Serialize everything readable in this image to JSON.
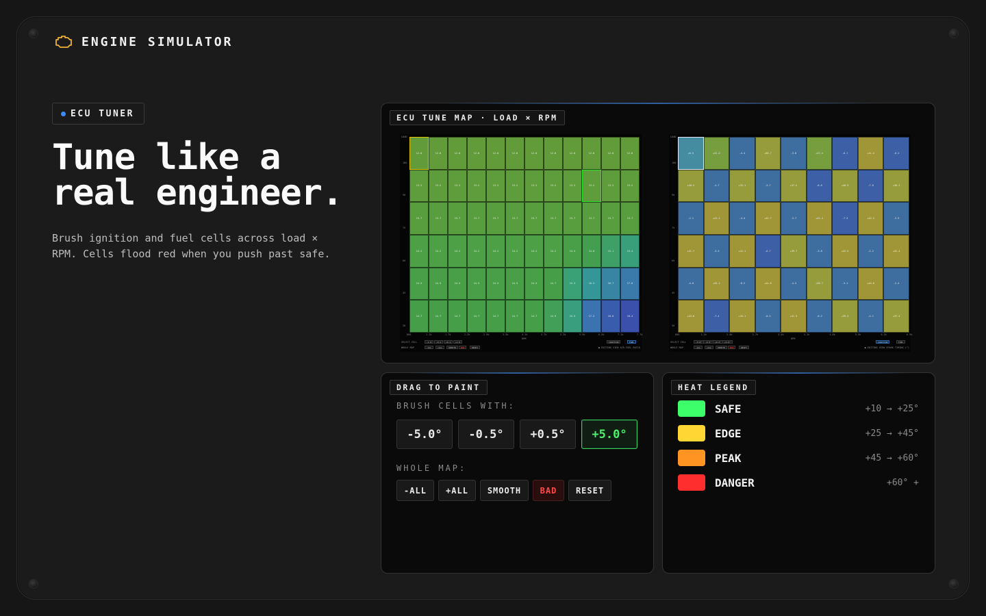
{
  "app": {
    "title": "ENGINE SIMULATOR",
    "icon": "engine-check-icon"
  },
  "hero": {
    "badge": "ECU TUNER",
    "title_line1": "Tune like a",
    "title_line2": "real engineer.",
    "subtitle": "Brush ignition and fuel cells across load × RPM. Cells flood red when you push past safe."
  },
  "map_panel": {
    "tag": "ECU TUNE MAP · LOAD × RPM",
    "fuel_map": {
      "y_labels": [
        "100",
        "90",
        "75",
        "60",
        "45",
        "30"
      ],
      "x_labels": [
        "800",
        "1.1k",
        "1.7k",
        "2.3k",
        "2.9k",
        "3.5k",
        "4.1k",
        "4.7k",
        "5.3k",
        "5.9k",
        "6.5k",
        "7.1k",
        "7.7k"
      ],
      "x_axis": "RPM",
      "rows": [
        [
          "12.8",
          "12.8",
          "12.8",
          "12.8",
          "12.8",
          "12.8",
          "12.8",
          "12.8",
          "12.8",
          "12.8",
          "12.8",
          "12.8"
        ],
        [
          "13.2",
          "13.2",
          "13.2",
          "13.2",
          "13.2",
          "13.2",
          "13.2",
          "13.2",
          "13.2",
          "13.2",
          "13.2",
          "13.2"
        ],
        [
          "13.7",
          "13.7",
          "13.7",
          "13.7",
          "13.7",
          "13.7",
          "13.7",
          "13.7",
          "13.7",
          "13.7",
          "13.7",
          "13.7"
        ],
        [
          "14.2",
          "14.2",
          "14.2",
          "14.2",
          "14.2",
          "14.2",
          "14.2",
          "14.2",
          "14.5",
          "14.8",
          "15.1",
          "15.4"
        ],
        [
          "14.5",
          "14.5",
          "14.5",
          "14.5",
          "14.5",
          "14.5",
          "14.5",
          "14.7",
          "15.3",
          "16.2",
          "16.7",
          "17.0"
        ],
        [
          "14.7",
          "14.7",
          "14.7",
          "14.7",
          "14.7",
          "14.7",
          "14.7",
          "14.9",
          "15.5",
          "17.2",
          "18.0",
          "18.4"
        ]
      ],
      "footer_row1": "SELECT CELL",
      "footer_row2": "WHOLE MAP",
      "mini_cells": [
        "-1.0",
        "-0.1",
        "+0.1",
        "+1.0"
      ],
      "mini_map": [
        "-ALL",
        "+ALL",
        "SMOOTH",
        "BAD",
        "RESET"
      ],
      "toggle": [
        "IGNITION",
        "FUEL"
      ],
      "caption": "● EDITING VIEW  AIR-FUEL RATIO"
    },
    "ignition_map": {
      "y_labels": [
        "100",
        "90",
        "75",
        "60",
        "45",
        "30"
      ],
      "x_labels": [
        "800",
        "1.2k",
        "2.0k",
        "2.7k",
        "3.4k",
        "4.1k",
        "4.8k",
        "5.5k",
        "6.2k",
        "6.9k"
      ],
      "x_axis": "RPM",
      "rows": [
        [
          "+0.5",
          "+31.2",
          "-4.4",
          "+38.7",
          "-3.8",
          "+27.4",
          "-6.7",
          "+41.2",
          "-6.2"
        ],
        [
          "+40.5",
          "-4.7",
          "+35.1",
          "-3.7",
          "+37.2",
          "-6.6",
          "+40.3",
          "-7.8",
          "+38.2"
        ],
        [
          "-2.1",
          "+41.1",
          "-4.4",
          "+42.7",
          "-3.7",
          "+41.4",
          "-7.3",
          "+42.3",
          "-3.9"
        ],
        [
          "+41.7",
          "-3.3",
          "+41.1",
          "-6.7",
          "+39.7",
          "-3.8",
          "+42.5",
          "-2.2",
          "+42.4"
        ],
        [
          "-4.0",
          "+43.1",
          "-0.2",
          "+44.8",
          "-4.5",
          "+36.7",
          "-3.1",
          "+44.6",
          "-2.4"
        ],
        [
          "+43.8",
          "-7.4",
          "+43.1",
          "-0.2",
          "+41.3",
          "-0.2",
          "+39.4",
          "-4.1",
          "+37.4"
        ]
      ],
      "footer_row1": "SELECT CELL",
      "footer_row2": "WHOLE MAP",
      "mini_cells": [
        "-5.0°",
        "-0.5°",
        "+0.5°",
        "+5.0°"
      ],
      "mini_map": [
        "-ALL",
        "+ALL",
        "SMOOTH",
        "BAD",
        "RESET"
      ],
      "toggle": [
        "IGNITION",
        "FUEL"
      ],
      "caption": "● EDITING VIEW  SPARK TIMING (°)"
    }
  },
  "paint_panel": {
    "tag": "DRAG TO PAINT",
    "brush_label": "BRUSH CELLS WITH:",
    "brush_buttons": [
      "-5.0°",
      "-0.5°",
      "+0.5°",
      "+5.0°"
    ],
    "active_brush": "+5.0°",
    "whole_label": "WHOLE MAP:",
    "whole_buttons": [
      "-ALL",
      "+ALL",
      "SMOOTH",
      "BAD",
      "RESET"
    ]
  },
  "legend_panel": {
    "tag": "HEAT LEGEND",
    "items": [
      {
        "name": "SAFE",
        "range": "+10 → +25°",
        "color": "#3dff6a"
      },
      {
        "name": "EDGE",
        "range": "+25 → +45°",
        "color": "#ffd633"
      },
      {
        "name": "PEAK",
        "range": "+45 → +60°",
        "color": "#ff9422"
      },
      {
        "name": "DANGER",
        "range": "+60° +",
        "color": "#ff2e2e"
      }
    ]
  }
}
